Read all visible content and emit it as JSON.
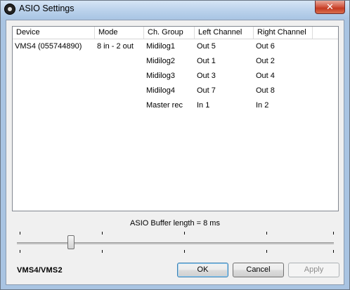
{
  "window": {
    "title": "ASIO Settings",
    "close_glyph": "✕"
  },
  "table": {
    "headers": [
      "Device",
      "Mode",
      "Ch. Group",
      "Left Channel",
      "Right Channel"
    ],
    "rows": [
      {
        "device": "VMS4 (055744890)",
        "mode": "8 in - 2 out",
        "group": "Midilog1",
        "left": "Out 5",
        "right": "Out 6"
      },
      {
        "device": "",
        "mode": "",
        "group": "Midilog2",
        "left": "Out 1",
        "right": "Out 2"
      },
      {
        "device": "",
        "mode": "",
        "group": "Midilog3",
        "left": "Out 3",
        "right": "Out 4"
      },
      {
        "device": "",
        "mode": "",
        "group": "Midilog4",
        "left": "Out 7",
        "right": "Out 8"
      },
      {
        "device": "",
        "mode": "",
        "group": "Master rec",
        "left": "In 1",
        "right": "In 2"
      }
    ]
  },
  "buffer": {
    "label": "ASIO Buffer length = 8 ms",
    "slider_fraction": 0.17
  },
  "brand": "VMS4/VMS2",
  "buttons": {
    "ok": "OK",
    "cancel": "Cancel",
    "apply": "Apply"
  }
}
